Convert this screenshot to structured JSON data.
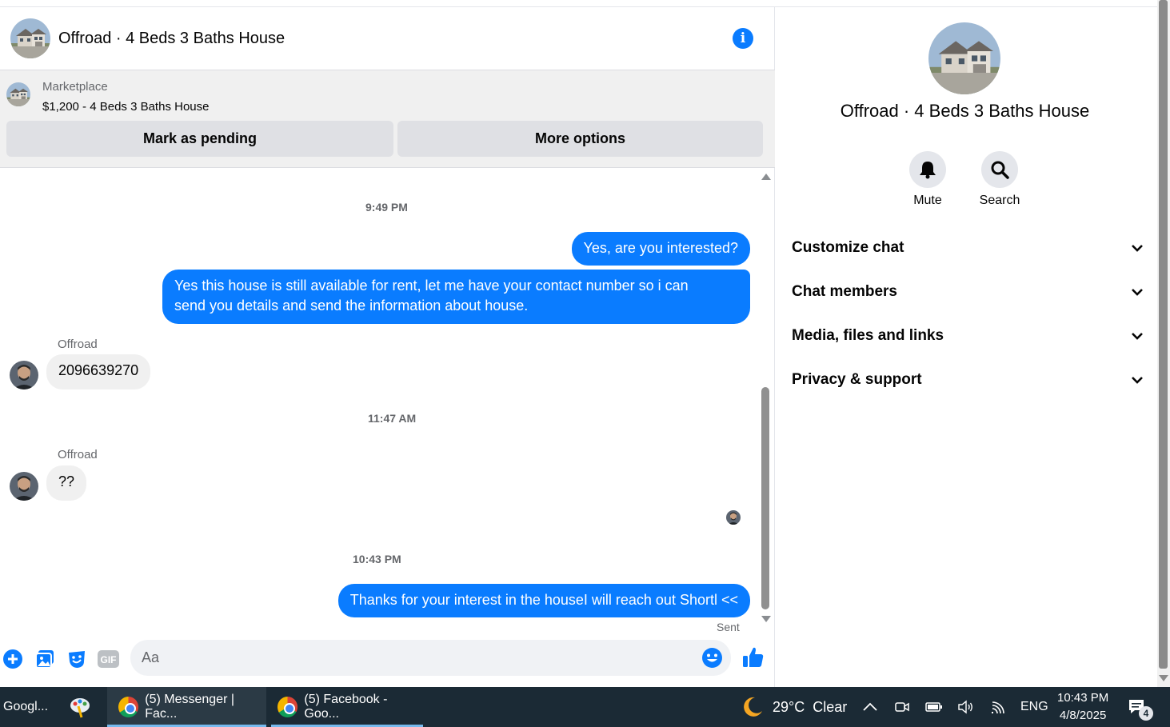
{
  "header": {
    "title": "Offroad · 4 Beds 3 Baths House"
  },
  "marketplace": {
    "label": "Marketplace",
    "item": "$1,200 - 4 Beds 3 Baths House",
    "pending_button": "Mark as pending",
    "more_button": "More options"
  },
  "messages": {
    "ts1": "9:49 PM",
    "out1": "Yes, are you interested?",
    "out2_line1": "Yes this house is still available for rent, let me have your contact number so i can",
    "out2_line2": "send you details and send the information about house.",
    "sender1": "Offroad",
    "in1": "2096639270",
    "ts2": "11:47 AM",
    "sender2": "Offroad",
    "in2": "??",
    "ts3": "10:43 PM",
    "out3": "Thanks for your interest in the houseI will reach out Shortl <<",
    "sent_status": "Sent"
  },
  "composer": {
    "placeholder": "Aa",
    "gif_label": "GIF"
  },
  "side": {
    "title": "Offroad · 4 Beds 3 Baths House",
    "mute": "Mute",
    "search": "Search",
    "sections": [
      "Customize chat",
      "Chat members",
      "Media, files and links",
      "Privacy & support"
    ]
  },
  "taskbar": {
    "item1": "Googl...",
    "item2": "(5) Messenger | Fac...",
    "item3": "(5) Facebook - Goo...",
    "weather_temp": "29°C",
    "weather_cond": "Clear",
    "lang": "ENG",
    "time": "10:43 PM",
    "date": "4/8/2025",
    "notif_count": "4"
  },
  "colors": {
    "accent": "#0a7cff",
    "taskbar": "#1b2a35"
  }
}
